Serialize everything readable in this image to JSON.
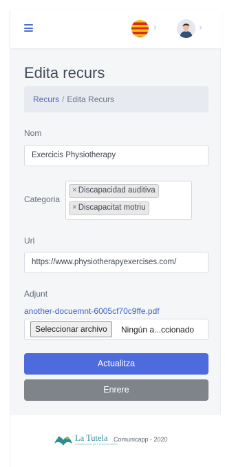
{
  "header": {
    "menu_icon": "hamburger-menu-icon",
    "language_flag": "catalan-flag",
    "user_icon": "user-avatar-icon",
    "chevron": "›",
    "colors": {
      "accent": "#4a6cd4"
    }
  },
  "page": {
    "title": "Edita recurs",
    "breadcrumb": {
      "link": "Recurs",
      "separator": "/",
      "current": "Edita Recurs"
    }
  },
  "form": {
    "nom": {
      "label": "Nom",
      "value": "Exercicis Physiotherapy"
    },
    "categoria": {
      "label": "Categoria",
      "tags": [
        "Discapacidad auditiva",
        "Discapacitat motriu"
      ],
      "remove_symbol": "×"
    },
    "url": {
      "label": "Url",
      "value": "https://www.physiotherapyexercises.com/"
    },
    "adjunt": {
      "label": "Adjunt",
      "current_file": "another-docuemnt-6005cf70c9ffe.pdf",
      "button_label": "Seleccionar archivo",
      "status": "Ningún a...ccionado"
    },
    "submit_label": "Actualitza",
    "back_label": "Enrere",
    "colors": {
      "primary": "#4d6bdc",
      "secondary": "#7f848b"
    }
  },
  "footer": {
    "brand": "La Tutela",
    "brand_tagline": "Fundació tutelar per a persones adultes",
    "text": "Comunicapp - 2020",
    "logo_icon": "la-tutela-logo"
  }
}
